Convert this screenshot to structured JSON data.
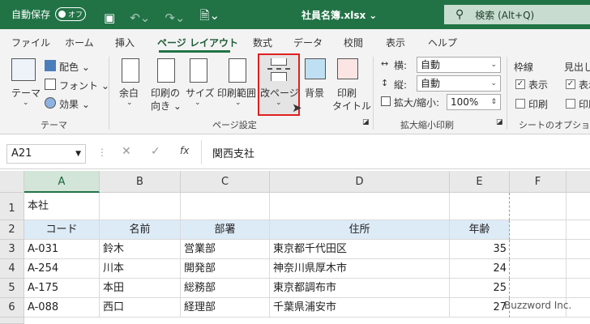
{
  "titlebar": {
    "autosave_label": "自動保存",
    "autosave_state": "オフ",
    "filename": "社員名簿.xlsx",
    "filename_arrow": "⌄",
    "search_placeholder": "検索 (Alt+Q)"
  },
  "tabs": [
    {
      "label": "ファイル"
    },
    {
      "label": "ホーム"
    },
    {
      "label": "挿入"
    },
    {
      "label": "ページ レイアウト"
    },
    {
      "label": "数式"
    },
    {
      "label": "データ"
    },
    {
      "label": "校閲"
    },
    {
      "label": "表示"
    },
    {
      "label": "ヘルプ"
    }
  ],
  "ribbon": {
    "theme": {
      "theme_btn": "テーマ",
      "colors": "配色",
      "fonts": "フォント",
      "effects": "効果",
      "group": "テーマ"
    },
    "page_setup": {
      "margins": "余白",
      "orientation": [
        "印刷の",
        "向き"
      ],
      "size": "サイズ",
      "print_area": "印刷範囲",
      "breaks": "改ページ",
      "background": "背景",
      "print_titles": [
        "印刷",
        "タイトル"
      ],
      "group": "ページ設定"
    },
    "scale": {
      "width_label": "横:",
      "width_value": "自動",
      "height_label": "縦:",
      "height_value": "自動",
      "scale_label": "拡大/縮小:",
      "scale_value": "100%",
      "group": "拡大縮小印刷"
    },
    "sheet_options": {
      "gridlines": "枠線",
      "headings": "見出し",
      "view": "表示",
      "print": "印刷",
      "group": "シートのオプション"
    }
  },
  "formula_bar": {
    "name_box": "A21",
    "fx": "fx",
    "content": "関西支社"
  },
  "sheet": {
    "columns": [
      "A",
      "B",
      "C",
      "D",
      "E",
      "F"
    ],
    "rows": [
      {
        "num": "1",
        "cells": [
          "本社",
          "",
          "",
          "",
          ""
        ]
      },
      {
        "num": "2",
        "cells": [
          "コード",
          "名前",
          "部署",
          "住所",
          "年齢"
        ]
      },
      {
        "num": "3",
        "cells": [
          "A-031",
          "鈴木",
          "営業部",
          "東京都千代田区",
          "35"
        ]
      },
      {
        "num": "4",
        "cells": [
          "A-254",
          "川本",
          "開発部",
          "神奈川県厚木市",
          "24"
        ]
      },
      {
        "num": "5",
        "cells": [
          "A-175",
          "本田",
          "総務部",
          "東京都調布市",
          "25"
        ]
      },
      {
        "num": "6",
        "cells": [
          "A-088",
          "西口",
          "経理部",
          "千葉県浦安市",
          "27"
        ]
      }
    ]
  },
  "watermark": "Buzzword Inc."
}
